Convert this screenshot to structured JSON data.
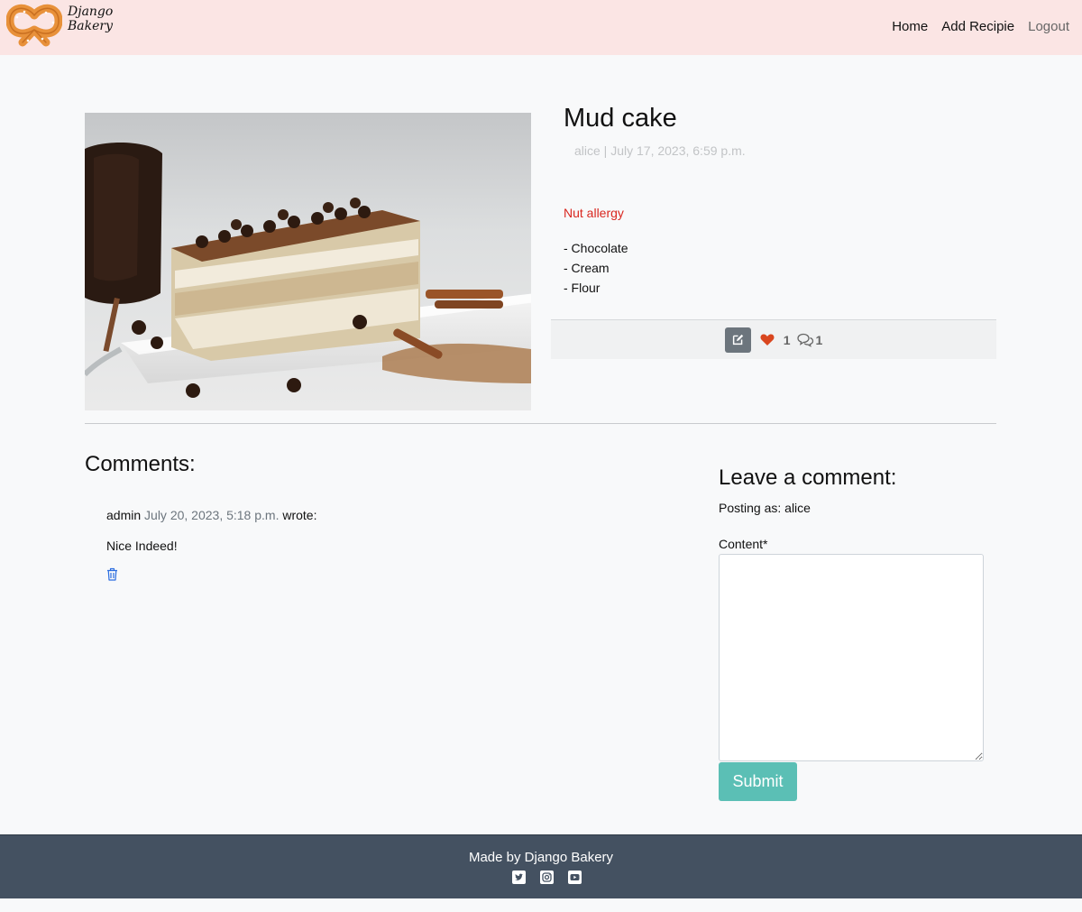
{
  "navbar": {
    "brand": "Django Bakery",
    "links": [
      "Home",
      "Add Recipie",
      "Logout"
    ]
  },
  "recipe": {
    "title": "Mud cake",
    "meta": "alice | July 17, 2023, 6:59 p.m.",
    "allergy": "Nut allergy",
    "ingredients": [
      "- Chocolate",
      "- Cream",
      "- Flour"
    ],
    "likes": "1",
    "comments_count": "1",
    "image": "cake-slice-photo"
  },
  "comments": {
    "heading": "Comments:",
    "items": [
      {
        "author": "admin",
        "date": "July 20, 2023, 5:18 p.m.",
        "suffix": "wrote:",
        "body": "Nice Indeed!"
      }
    ]
  },
  "form": {
    "heading": "Leave a comment:",
    "posting_as": "Posting as: alice",
    "content_label": "Content*",
    "content_value": "",
    "submit": "Submit"
  },
  "footer": {
    "text": "Made by Django Bakery",
    "social_icons": [
      "twitter-icon",
      "instagram-icon",
      "youtube-icon"
    ]
  },
  "colors": {
    "navbar_bg": "#fbe5e4",
    "allergy": "#d9271f",
    "like": "#d9461f",
    "submit_bg": "#5bbfb5",
    "footer_bg": "#445161",
    "delete_icon": "#2b6de0"
  }
}
